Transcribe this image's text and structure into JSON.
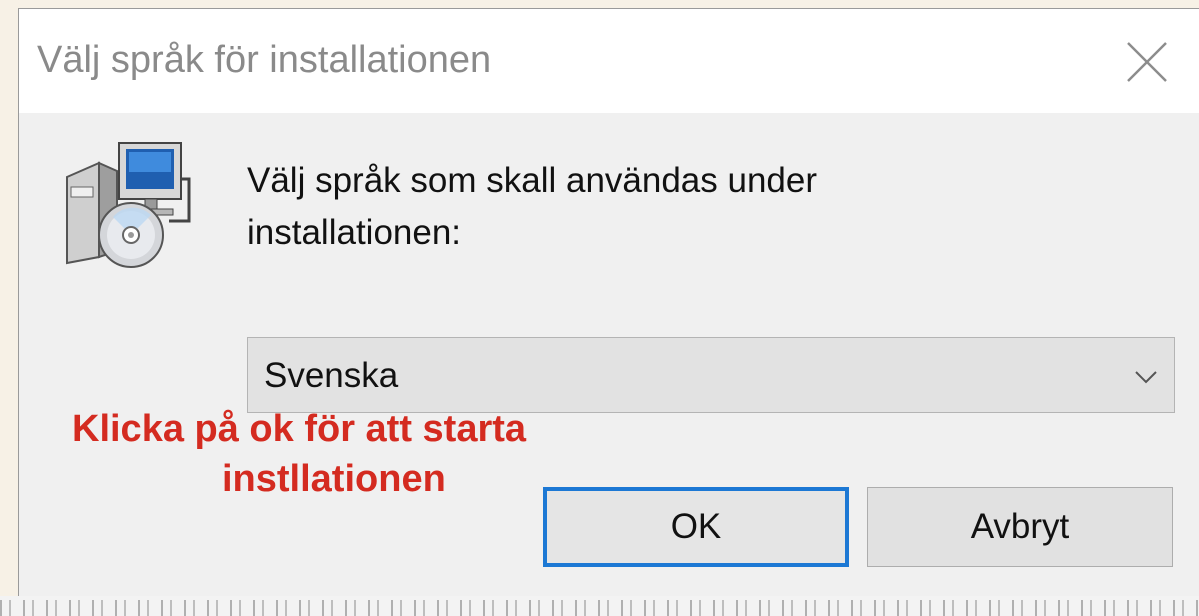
{
  "window": {
    "title": "Välj språk för installationen",
    "close_icon": "close-icon"
  },
  "dialog": {
    "icon": "installer-cd-monitor-icon",
    "prompt": "Välj språk som skall användas under installationen:",
    "language_select": {
      "selected": "Svenska",
      "chevron_icon": "chevron-down-icon"
    },
    "annotation": {
      "line1": "Klicka på ok för att starta",
      "line2": "instllationen",
      "color": "#d42b20"
    },
    "buttons": {
      "ok_label": "OK",
      "cancel_label": "Avbryt"
    }
  },
  "colors": {
    "focus_border": "#1c78d4",
    "dialog_bg": "#f0f0f0",
    "titlebar_bg": "#ffffff"
  }
}
